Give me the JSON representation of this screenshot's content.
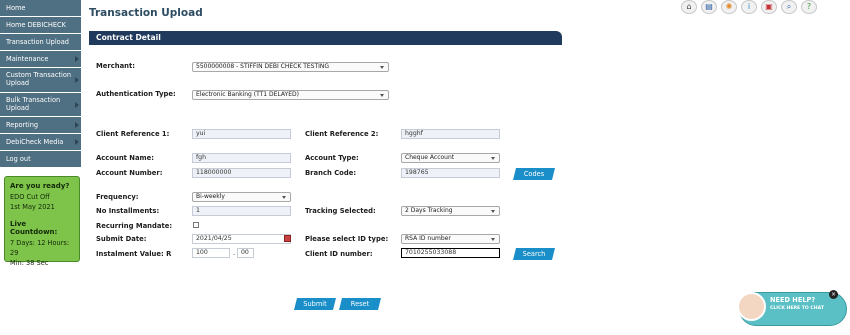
{
  "sidebar": {
    "items": [
      {
        "label": "Home"
      },
      {
        "label": "Home DEBICHECK"
      },
      {
        "label": "Transaction Upload"
      },
      {
        "label": "Maintenance"
      },
      {
        "label": "Custom Transaction Upload"
      },
      {
        "label": "Bulk Transaction Upload"
      },
      {
        "label": "Reporting"
      },
      {
        "label": "DebiCheck Media"
      },
      {
        "label": "Log out"
      }
    ]
  },
  "ready_box": {
    "title": "Are you ready?",
    "line1": "EDO Cut Off",
    "line2": "1st May 2021",
    "countdown_title": "Live Countdown:",
    "countdown_line1": "7 Days: 12 Hours: 29",
    "countdown_line2": "Min: 38 Sec"
  },
  "header": {
    "title": "Transaction Upload"
  },
  "top_icons": [
    "home-icon",
    "document-icon",
    "settings-icon",
    "info-icon",
    "printer-icon",
    "search-icon",
    "help-icon"
  ],
  "section": {
    "title": "Contract Detail"
  },
  "form": {
    "merchant_label": "Merchant:",
    "merchant_value": "5500000008 - STIFFIN DEBI CHECK TESTING",
    "auth_label": "Authentication Type:",
    "auth_value": "Electronic Banking (TT1 DELAYED)",
    "client_ref1_label": "Client Reference 1:",
    "client_ref1_value": "yui",
    "client_ref2_label": "Client Reference 2:",
    "client_ref2_value": "hgghf",
    "account_name_label": "Account Name:",
    "account_name_value": "fgh",
    "account_type_label": "Account Type:",
    "account_type_value": "Cheque Account",
    "account_number_label": "Account Number:",
    "account_number_value": "118000000",
    "branch_code_label": "Branch Code:",
    "branch_code_value": "198765",
    "codes_button": "Codes",
    "frequency_label": "Frequency:",
    "frequency_value": "Bi-weekly",
    "installments_label": "No Installments:",
    "installments_value": "1",
    "tracking_label": "Tracking Selected:",
    "tracking_value": "2 Days Tracking",
    "recurring_label": "Recurring Mandate:",
    "submit_date_label": "Submit Date:",
    "submit_date_value": "2021/04/25",
    "id_type_label": "Please select ID type:",
    "id_type_value": "RSA ID number",
    "instalment_label": "Instalment Value: R",
    "instalment_rands": "100",
    "instalment_sep": ".",
    "instalment_cents": "00",
    "client_id_label": "Client ID number:",
    "client_id_value": "7010255033088",
    "search_button": "Search",
    "submit_button": "Submit",
    "reset_button": "Reset"
  },
  "help": {
    "title": "NEED HELP?",
    "subtitle": "CLICK HERE TO CHAT",
    "close": "×"
  }
}
